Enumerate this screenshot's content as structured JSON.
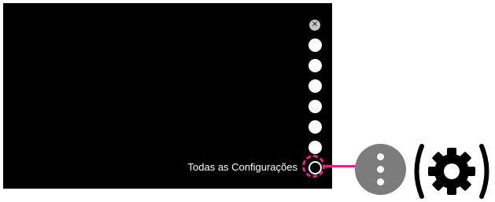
{
  "menu": {
    "close_icon": "close-icon",
    "items": [
      {
        "icon": "menu-item-icon"
      },
      {
        "icon": "menu-item-icon"
      },
      {
        "icon": "menu-item-icon"
      },
      {
        "icon": "menu-item-icon"
      },
      {
        "icon": "menu-item-icon"
      },
      {
        "icon": "menu-item-icon"
      }
    ],
    "settings_label": "Todas as Configurações",
    "settings_icon": "settings-icon"
  },
  "remote": {
    "button_icon": "more-vertical-icon",
    "gear_icon": "gear-icon"
  },
  "colors": {
    "screen": "#000000",
    "highlight": "#e0248a",
    "remote_button": "#7c7c7c"
  }
}
